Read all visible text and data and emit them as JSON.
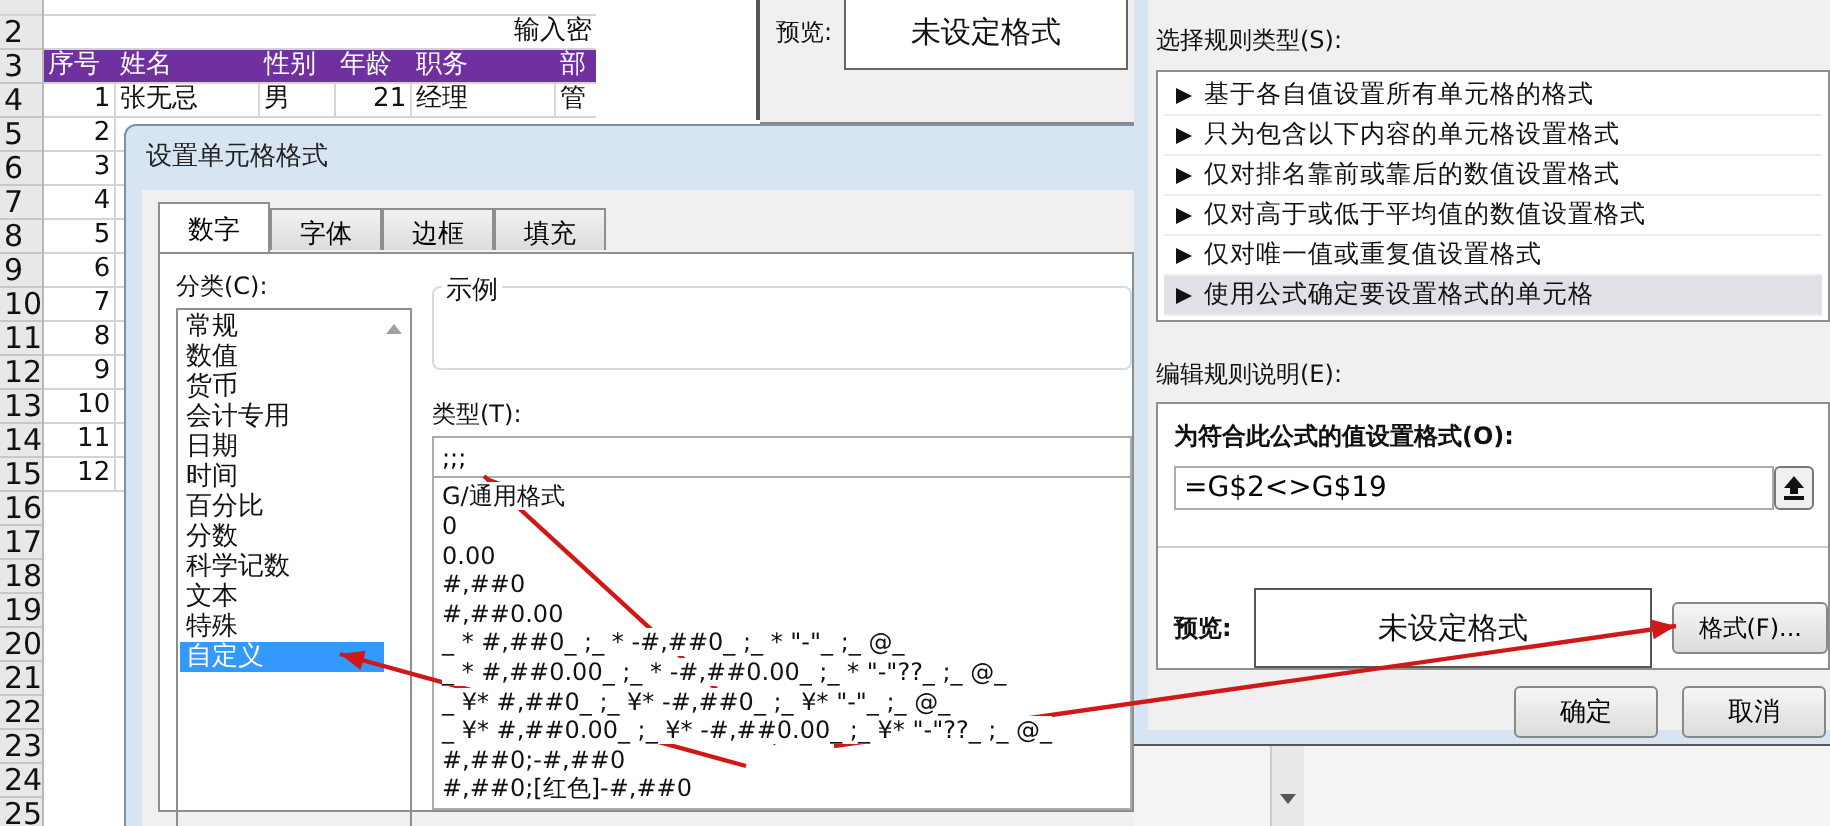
{
  "spreadsheet": {
    "row_numbers": [
      "2",
      "3",
      "4",
      "5",
      "6",
      "7",
      "8",
      "9",
      "10",
      "11",
      "12",
      "13",
      "14",
      "15",
      "16",
      "17",
      "18",
      "19",
      "20",
      "21",
      "22",
      "23",
      "24",
      "25"
    ],
    "banner": "输入密",
    "columns": [
      "序号",
      "姓名",
      "性别",
      "年龄",
      "职务",
      "部"
    ],
    "rows": [
      [
        "1",
        "张无忌",
        "男",
        "21",
        "经理",
        "管"
      ],
      [
        "2"
      ],
      [
        "3"
      ],
      [
        "4"
      ],
      [
        "5"
      ],
      [
        "6"
      ],
      [
        "7"
      ],
      [
        "8"
      ],
      [
        "9"
      ],
      [
        "10"
      ],
      [
        "11"
      ],
      [
        "12"
      ]
    ]
  },
  "back_dialog": {
    "preview_label": "预览:",
    "preview_value": "未设定格式"
  },
  "format_cells_dialog": {
    "title": "设置单元格格式",
    "tabs": [
      {
        "label": "数字",
        "selected": true
      },
      {
        "label": "字体",
        "selected": false
      },
      {
        "label": "边框",
        "selected": false
      },
      {
        "label": "填充",
        "selected": false
      }
    ],
    "category_label": "分类(C):",
    "categories": [
      {
        "label": "常规",
        "selected": false
      },
      {
        "label": "数值",
        "selected": false
      },
      {
        "label": "货币",
        "selected": false
      },
      {
        "label": "会计专用",
        "selected": false
      },
      {
        "label": "日期",
        "selected": false
      },
      {
        "label": "时间",
        "selected": false
      },
      {
        "label": "百分比",
        "selected": false
      },
      {
        "label": "分数",
        "selected": false
      },
      {
        "label": "科学记数",
        "selected": false
      },
      {
        "label": "文本",
        "selected": false
      },
      {
        "label": "特殊",
        "selected": false
      },
      {
        "label": "自定义",
        "selected": true
      }
    ],
    "sample_label": "示例",
    "type_label": "类型(T):",
    "type_value": ";;;",
    "type_options": [
      "G/通用格式",
      "0",
      "0.00",
      "#,##0",
      "#,##0.00",
      "_ * #,##0_ ;_ * -#,##0_ ;_ * \"-\"_ ;_ @_",
      "_ * #,##0.00_ ;_ * -#,##0.00_ ;_ * \"-\"??_ ;_ @_",
      "_ ¥* #,##0_ ;_ ¥* -#,##0_ ;_ ¥* \"-\"_ ;_ @_",
      "_ ¥* #,##0.00_ ;_ ¥* -#,##0.00_ ;_ ¥* \"-\"??_ ;_ @_",
      "#,##0;-#,##0",
      "#,##0;[红色]-#,##0"
    ]
  },
  "rule_dialog": {
    "rule_type_label": "选择规则类型(S):",
    "rule_types": [
      {
        "label": "基于各自值设置所有单元格的格式",
        "selected": false
      },
      {
        "label": "只为包含以下内容的单元格设置格式",
        "selected": false
      },
      {
        "label": "仅对排名靠前或靠后的数值设置格式",
        "selected": false
      },
      {
        "label": "仅对高于或低于平均值的数值设置格式",
        "selected": false
      },
      {
        "label": "仅对唯一值或重复值设置格式",
        "selected": false
      },
      {
        "label": "使用公式确定要设置格式的单元格",
        "selected": true
      }
    ],
    "edit_label": "编辑规则说明(E):",
    "formula_label": "为符合此公式的值设置格式(O):",
    "formula_value": "=G$2<>G$19",
    "preview_label": "预览:",
    "preview_value": "未设定格式",
    "format_button": "格式(F)...",
    "ok_button": "确定",
    "cancel_button": "取消"
  }
}
